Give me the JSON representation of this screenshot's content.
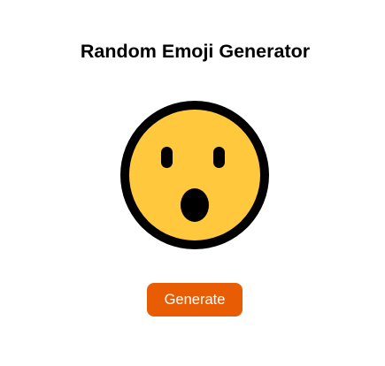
{
  "app": {
    "title": "Random Emoji Generator"
  },
  "emoji": {
    "icon": "astonished-face-icon",
    "face_color": "#FFC83D",
    "outline_color": "#000000"
  },
  "controls": {
    "generate_label": "Generate",
    "accent_color": "#E85D04"
  }
}
